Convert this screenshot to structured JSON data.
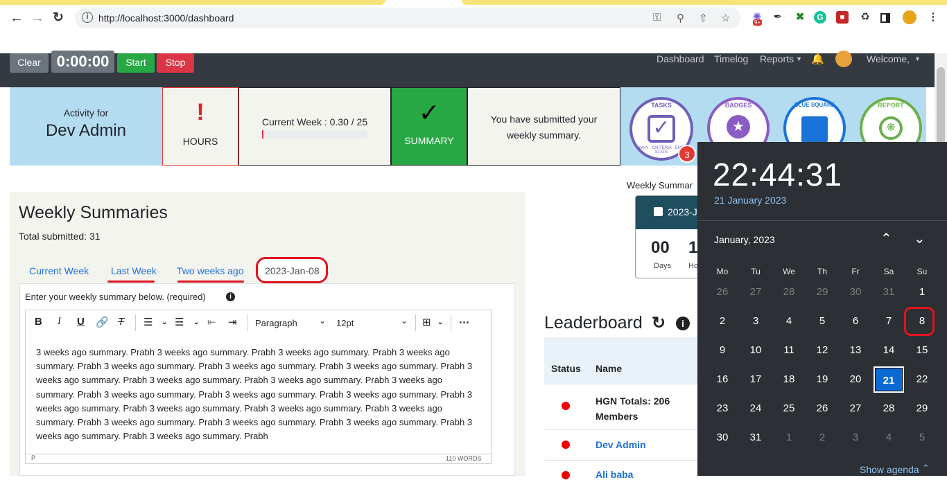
{
  "browser": {
    "url": "http://localhost:3000/dashboard",
    "ext_badge": "9+"
  },
  "navbar": {
    "clear_label": "Clear",
    "timer": "0:00:00",
    "start_label": "Start",
    "stop_label": "Stop",
    "links": [
      "Dashboard",
      "Timelog",
      "Reports",
      "Welcome,"
    ]
  },
  "activity": {
    "label": "Activity for",
    "name": "Dev Admin",
    "hours_icon": "!",
    "hours_label": "HOURS",
    "current_week": "Current Week : 0.30 / 25",
    "progress_fraction": 0.012,
    "summary_icon": "✓",
    "summary_label": "SUMMARY",
    "submitted_msg": "You have submitted your weekly summary.",
    "badges": [
      {
        "text": "TASKS",
        "sub": "WHY · CRITERIA · END STATE",
        "color": "#6f5fb8"
      },
      {
        "text": "BADGES",
        "color": "#8a5cc4"
      },
      {
        "text": "BLUE SQUARE",
        "color": "#1a73d9"
      },
      {
        "text": "REPORT",
        "color": "#6cb04c"
      }
    ],
    "badge_count": "3"
  },
  "weekly": {
    "title": "Weekly Summaries",
    "total": "Total submitted: 31",
    "tabs": [
      "Current Week",
      "Last Week",
      "Two weeks ago",
      "2023-Jan-08"
    ],
    "prompt": "Enter your weekly summary below. (required)",
    "format": "Paragraph",
    "size": "12pt",
    "text": "3 weeks ago summary. Prabh 3 weeks ago summary. Prabh 3 weeks ago summary. Prabh 3 weeks ago summary. Prabh 3 weeks ago summary. Prabh 3 weeks ago summary. Prabh 3 weeks ago summary. Prabh 3 weeks ago summary. Prabh 3 weeks ago summary. Prabh 3 weeks ago summary. Prabh 3 weeks ago summary. Prabh 3 weeks ago summary. Prabh 3 weeks ago summary. Prabh 3 weeks ago summary. Prabh 3 weeks ago summary. Prabh 3 weeks ago summary. Prabh 3 weeks ago summary. Prabh 3 weeks ago summary. Prabh 3 weeks ago summary. Prabh 3 weeks ago summary. Prabh 3 weeks ago summary. Prabh 3 weeks ago summary. Prabh 3 weeks ago summary. Prabh",
    "status_path": "P",
    "word_count": "110 WORDS"
  },
  "countdown": {
    "heading": "Weekly Summar",
    "date": "2023-J",
    "days": "00",
    "days_label": "Days",
    "hours": "1",
    "hours_label": "Ho"
  },
  "leaderboard": {
    "title": "Leaderboard",
    "col_status": "Status",
    "col_name": "Name",
    "rows": [
      {
        "name": "HGN Totals: 206 Members",
        "line1": "HGN Totals: 206",
        "line2": "Members"
      },
      {
        "name": "Dev Admin"
      },
      {
        "name": "Ali baba"
      }
    ]
  },
  "clock": {
    "time": "22:44:31",
    "date": "21 January 2023",
    "month": "January, 2023",
    "weekdays": [
      "Mo",
      "Tu",
      "We",
      "Th",
      "Fr",
      "Sa",
      "Su"
    ],
    "days": [
      26,
      27,
      28,
      29,
      30,
      31,
      1,
      2,
      3,
      4,
      5,
      6,
      7,
      8,
      9,
      10,
      11,
      12,
      13,
      14,
      15,
      16,
      17,
      18,
      19,
      20,
      21,
      22,
      23,
      24,
      25,
      26,
      27,
      28,
      29,
      30,
      31,
      1,
      2,
      3,
      4,
      5
    ],
    "today": 21,
    "show_agenda": "Show agenda"
  }
}
